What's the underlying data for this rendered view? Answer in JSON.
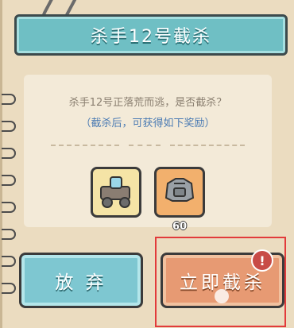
{
  "dialog": {
    "title": "杀手12号截杀",
    "question": "杀手12号正落荒而逃，是否截杀？",
    "hint": "（截杀后，可获得如下奖励）"
  },
  "rewards": [
    {
      "name": "cart-of-supplies",
      "count": ""
    },
    {
      "name": "iron-armor",
      "count": "60"
    }
  ],
  "buttons": {
    "abandon": "放 弃",
    "intercept": "立即截杀"
  },
  "badge": "!",
  "colors": {
    "banner": "#6fbfc4",
    "abandon": "#7ec7d1",
    "intercept": "#e79a73",
    "highlight": "#e23b3b"
  }
}
